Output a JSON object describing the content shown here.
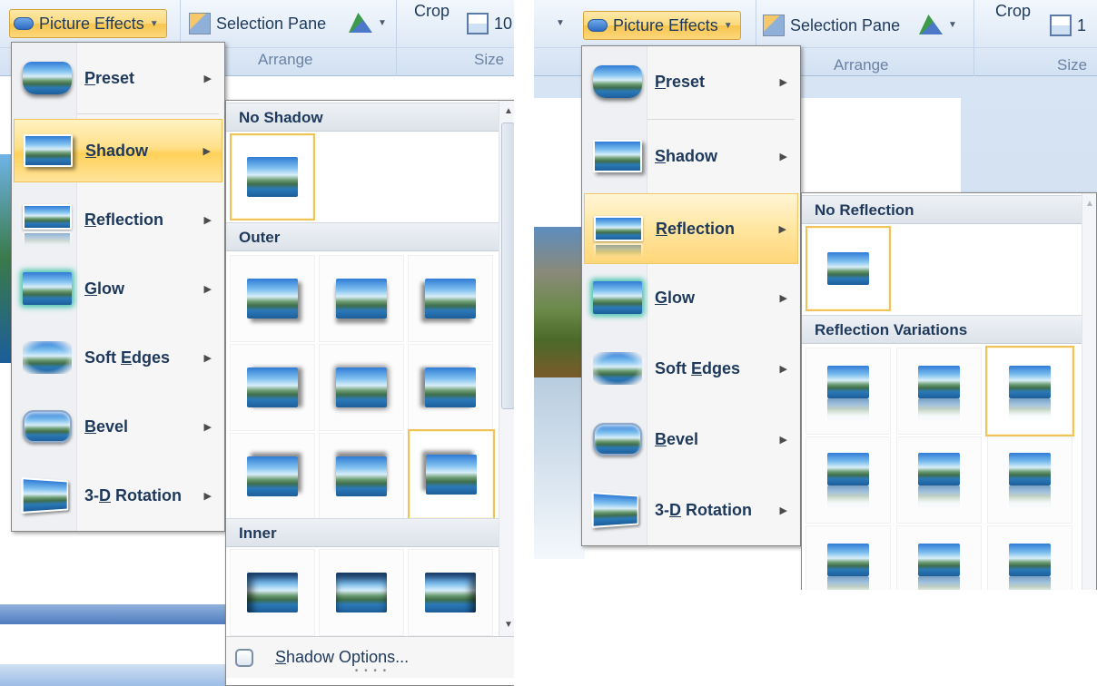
{
  "left": {
    "ribbon": {
      "picture_effects": "Picture Effects",
      "selection_pane": "Selection Pane",
      "crop": "Crop",
      "size_value": "10",
      "arrange_label": "Arrange",
      "size_label": "Size"
    },
    "menu": {
      "items": [
        {
          "pre": "",
          "key": "P",
          "post": "reset"
        },
        {
          "pre": "",
          "key": "S",
          "post": "hadow"
        },
        {
          "pre": "",
          "key": "R",
          "post": "eflection"
        },
        {
          "pre": "",
          "key": "G",
          "post": "low"
        },
        {
          "pre": "Soft ",
          "key": "E",
          "post": "dges"
        },
        {
          "pre": "",
          "key": "B",
          "post": "evel"
        },
        {
          "pre": "3-",
          "key": "D",
          "post": " Rotation"
        }
      ]
    },
    "gallery": {
      "no_shadow": "No Shadow",
      "outer": "Outer",
      "inner": "Inner",
      "options_key": "S",
      "options_rest": "hadow Options..."
    }
  },
  "right": {
    "ribbon": {
      "picture_effects": "Picture Effects",
      "selection_pane": "Selection Pane",
      "crop": "Crop",
      "size_value": "1",
      "arrange_label": "Arrange",
      "size_label": "Size"
    },
    "menu": {
      "items": [
        {
          "pre": "",
          "key": "P",
          "post": "reset"
        },
        {
          "pre": "",
          "key": "S",
          "post": "hadow"
        },
        {
          "pre": "",
          "key": "R",
          "post": "eflection"
        },
        {
          "pre": "",
          "key": "G",
          "post": "low"
        },
        {
          "pre": "Soft ",
          "key": "E",
          "post": "dges"
        },
        {
          "pre": "",
          "key": "B",
          "post": "evel"
        },
        {
          "pre": "3-",
          "key": "D",
          "post": " Rotation"
        }
      ]
    },
    "gallery": {
      "no_reflection": "No Reflection",
      "variations": "Reflection Variations"
    }
  },
  "colors": {
    "highlight": "#ffd15a",
    "menu_text": "#1e395b",
    "ribbon_bg": "#dfe9f6",
    "selection_border": "#f0c35a"
  }
}
